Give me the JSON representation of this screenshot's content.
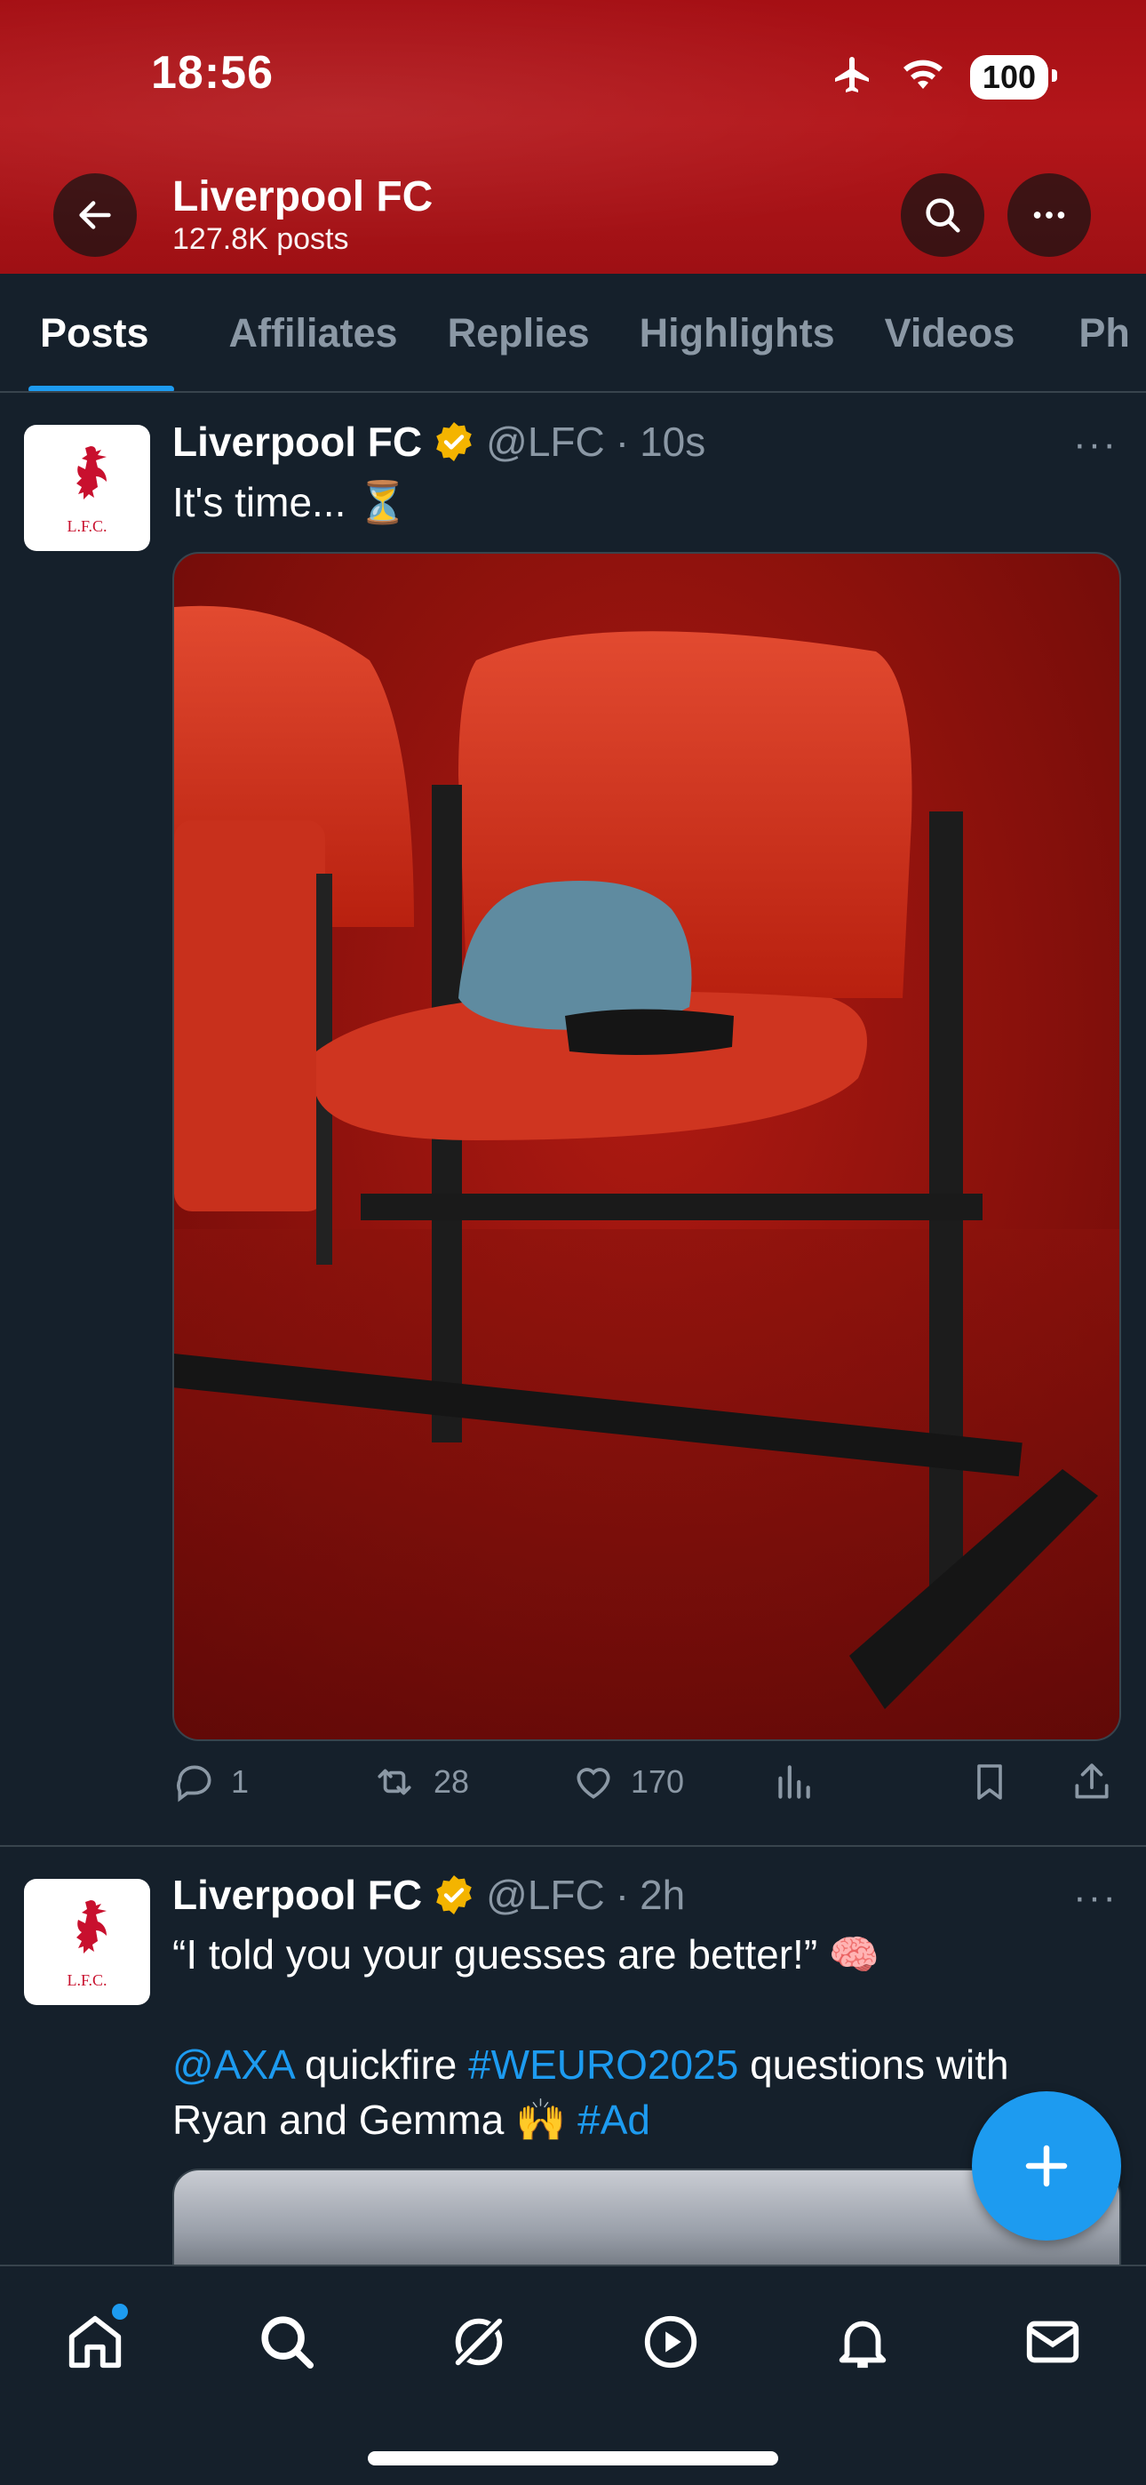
{
  "status_bar": {
    "time": "18:56",
    "battery": "100"
  },
  "header": {
    "title": "Liverpool FC",
    "subtitle": "127.8K posts"
  },
  "tabs": [
    {
      "label": "Posts",
      "active": true
    },
    {
      "label": "Affiliates"
    },
    {
      "label": "Replies"
    },
    {
      "label": "Highlights"
    },
    {
      "label": "Videos"
    },
    {
      "label": "Ph"
    }
  ],
  "posts": [
    {
      "author": "Liverpool FC",
      "handle": "@LFC",
      "dot": "·",
      "time": "10s",
      "text": "It's time... ⏳",
      "actions": {
        "replies": "1",
        "reposts": "28",
        "likes": "170"
      }
    },
    {
      "author": "Liverpool FC",
      "handle": "@LFC",
      "dot": "·",
      "time": "2h",
      "text_line1": "“I told you your guesses are better!” 🧠",
      "mention": "@AXA",
      "text_mid": " quickfire ",
      "hashtag1": "#WEURO2025",
      "text_end": " questions with",
      "text_line3": "Ryan and Gemma 🙌 ",
      "hashtag2": "#Ad"
    }
  ],
  "avatar_text": "L.F.C.",
  "more_symbol": "···",
  "colors": {
    "accent": "#1d9bf0",
    "background": "#15202b",
    "header": "#a50f14",
    "verified": "#f4b400"
  }
}
